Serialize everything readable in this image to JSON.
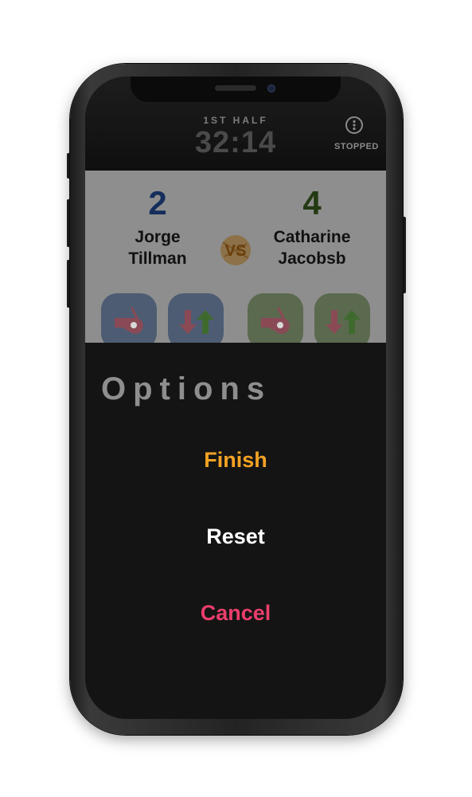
{
  "header": {
    "period_label": "1ST HALF",
    "clock": "32:14",
    "status": "STOPPED",
    "more_icon": "more-vertical-icon"
  },
  "match": {
    "home": {
      "score": "2",
      "name_line1": "Jorge",
      "name_line2": "Tillman",
      "color": "#152e5c"
    },
    "away": {
      "score": "4",
      "name_line1": "Catharine",
      "name_line2": "Jacobsb",
      "color": "#233a13"
    },
    "vs_icon": "vs-badge-icon",
    "actions": [
      {
        "team": "home",
        "icon": "whistle-foul-icon"
      },
      {
        "team": "home",
        "icon": "substitution-arrows-icon"
      },
      {
        "team": "away",
        "icon": "whistle-foul-icon"
      },
      {
        "team": "away",
        "icon": "substitution-arrows-icon"
      }
    ]
  },
  "options_sheet": {
    "title": "Options",
    "items": [
      {
        "label": "Finish",
        "color": "#f4a224"
      },
      {
        "label": "Reset",
        "color": "#ffffff"
      },
      {
        "label": "Cancel",
        "color": "#ea3e6c"
      }
    ]
  }
}
